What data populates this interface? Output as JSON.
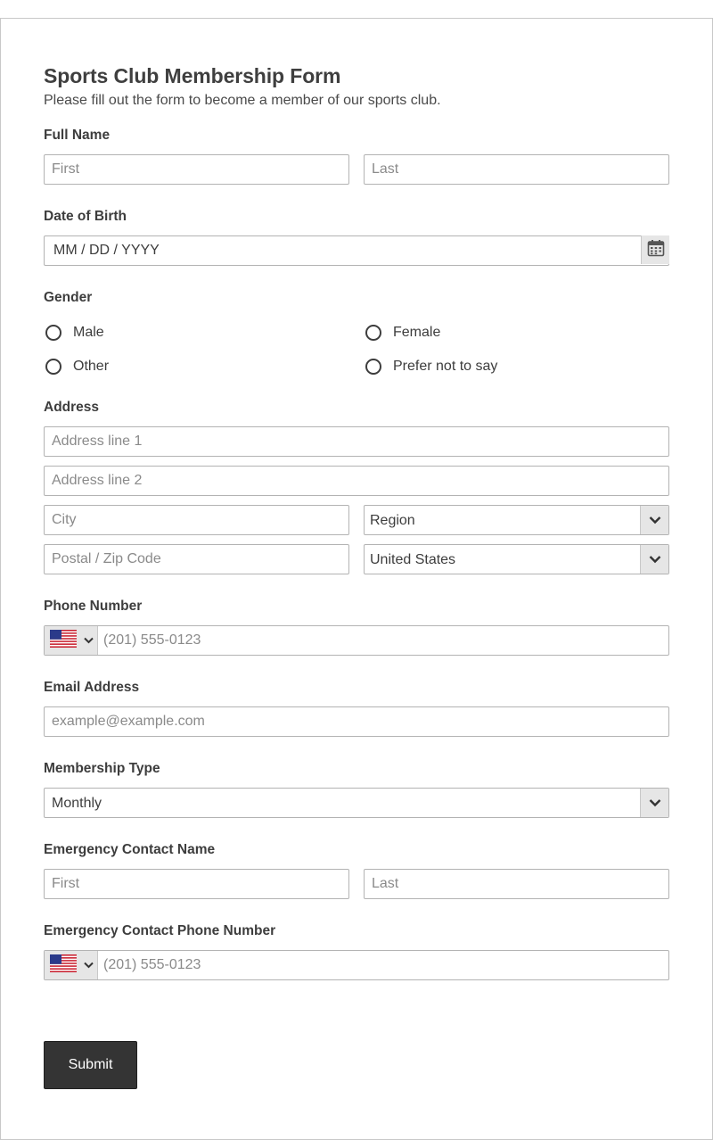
{
  "form": {
    "title": "Sports Club Membership Form",
    "subtitle": "Please fill out the form to become a member of our sports club."
  },
  "full_name": {
    "label": "Full Name",
    "first_placeholder": "First",
    "last_placeholder": "Last"
  },
  "dob": {
    "label": "Date of Birth",
    "placeholder": "MM / DD / YYYY",
    "icon": "calendar-icon"
  },
  "gender": {
    "label": "Gender",
    "options": [
      "Male",
      "Female",
      "Other",
      "Prefer not to say"
    ]
  },
  "address": {
    "label": "Address",
    "line1_placeholder": "Address line 1",
    "line2_placeholder": "Address line 2",
    "city_placeholder": "City",
    "region_value": "Region",
    "postal_placeholder": "Postal / Zip Code",
    "country_value": "United States"
  },
  "phone": {
    "label": "Phone Number",
    "placeholder": "(201) 555-0123",
    "flag": "us-flag-icon"
  },
  "email": {
    "label": "Email Address",
    "placeholder": "example@example.com"
  },
  "membership": {
    "label": "Membership Type",
    "value": "Monthly"
  },
  "emergency_name": {
    "label": "Emergency Contact Name",
    "first_placeholder": "First",
    "last_placeholder": "Last"
  },
  "emergency_phone": {
    "label": "Emergency Contact Phone Number",
    "placeholder": "(201) 555-0123",
    "flag": "us-flag-icon"
  },
  "submit": {
    "label": "Submit"
  },
  "colors": {
    "button_bg": "#343434",
    "border": "#b3b3b3",
    "text": "#3d3d3d",
    "addon_bg": "#e6e6e6"
  }
}
